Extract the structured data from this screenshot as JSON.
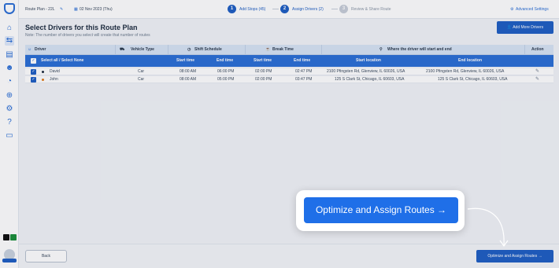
{
  "topbar": {
    "route_name": "Route Plan - 22L",
    "date": "02 Nov 2023 (Thu)",
    "steps": [
      {
        "number": "1",
        "label": "Add Stops (45)",
        "state": "active"
      },
      {
        "number": "2",
        "label": "Assign Drivers (2)",
        "state": "active"
      },
      {
        "number": "3",
        "label": "Review & Share Route",
        "state": "inactive"
      }
    ],
    "advanced_settings": "Advanced Settings"
  },
  "sidebar": {
    "items": [
      {
        "icon": "home-icon"
      },
      {
        "icon": "route-icon",
        "active": true
      },
      {
        "icon": "document-icon"
      },
      {
        "icon": "users-icon"
      },
      {
        "icon": "history-icon"
      },
      {
        "icon": "location-icon"
      },
      {
        "icon": "settings-icon"
      },
      {
        "icon": "help-icon"
      },
      {
        "icon": "chat-icon"
      }
    ]
  },
  "page": {
    "title": "Select Drivers for this Route Plan",
    "subtitle": "Note: The number of drivers you select will create that number of routes",
    "add_more_drivers": "Add More Drivers"
  },
  "table": {
    "group_headers": {
      "driver": "Driver",
      "vehicle_type": "Vehicle Type",
      "shift_schedule": "Shift Schedule",
      "break_time": "Break Time",
      "location": "Where the driver will start and end",
      "action": "Action"
    },
    "sub_headers": {
      "select_all": "Select all / Select None",
      "shift_start": "Start time",
      "shift_end": "End time",
      "break_start": "Start time",
      "break_end": "End time",
      "start_location": "Start location",
      "end_location": "End location"
    },
    "rows": [
      {
        "name": "David",
        "dot_color": "#1c2b3e",
        "vehicle": "Car",
        "shift_start": "08:00 AM",
        "shift_end": "06:00 PM",
        "break_start": "02:00 PM",
        "break_end": "02:47 PM",
        "start_location": "2100 Pfingsten Rd, Glenview, IL 60026, USA",
        "end_location": "2100 Pfingsten Rd, Glenview, IL 60026, USA"
      },
      {
        "name": "John",
        "dot_color": "#e07b1a",
        "vehicle": "Car",
        "shift_start": "08:00 AM",
        "shift_end": "05:00 PM",
        "break_start": "02:00 PM",
        "break_end": "03:47 PM",
        "start_location": "125 S Clark St, Chicago, IL 60603, USA",
        "end_location": "125 S Clark St, Chicago, IL 60603, USA"
      }
    ]
  },
  "highlight": {
    "label": "Optimize and Assign Routes →"
  },
  "footer": {
    "back": "Back",
    "optimize": "Optimize and Assign Routes →"
  },
  "colors": {
    "primary": "#1f5fc4",
    "highlight_button": "#1f6fe8",
    "header_band": "#2b6fd6"
  }
}
